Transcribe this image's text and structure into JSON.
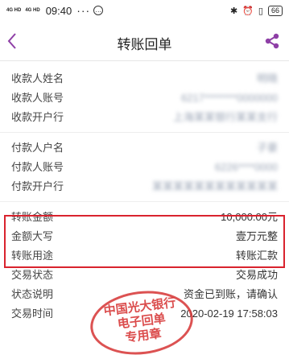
{
  "status_bar": {
    "signal_1": "4G HD",
    "signal_2": "4G HD",
    "time": "09:40",
    "dots": "···",
    "battery": "66"
  },
  "header": {
    "title": "转账回单"
  },
  "payee": [
    {
      "label": "收款人姓名",
      "value": "明晓"
    },
    {
      "label": "收款人账号",
      "value": "6217********0000000"
    },
    {
      "label": "收款开户行",
      "value": "上海某某银行某某支行"
    }
  ],
  "payer": [
    {
      "label": "付款人户名",
      "value": "子豪"
    },
    {
      "label": "付款人账号",
      "value": "6226****0000"
    },
    {
      "label": "付款开户行",
      "value": "某某某某某某某某某某某某"
    }
  ],
  "transfer": [
    {
      "label": "转账金额",
      "value": "10,000.00元"
    },
    {
      "label": "金额大写",
      "value": "壹万元整"
    },
    {
      "label": "转账用途",
      "value": "转账汇款"
    },
    {
      "label": "交易状态",
      "value": "交易成功"
    },
    {
      "label": "状态说明",
      "value": "资金已到账，请确认"
    },
    {
      "label": "交易时间",
      "value": "2020-02-19 17:58:03"
    }
  ],
  "stamp": {
    "line1": "中国光大银行",
    "line2": "电子回单",
    "line3": "专用章"
  },
  "colors": {
    "accent": "#8e3fa6",
    "highlight": "#d9232e",
    "stamp": "#d63434"
  }
}
